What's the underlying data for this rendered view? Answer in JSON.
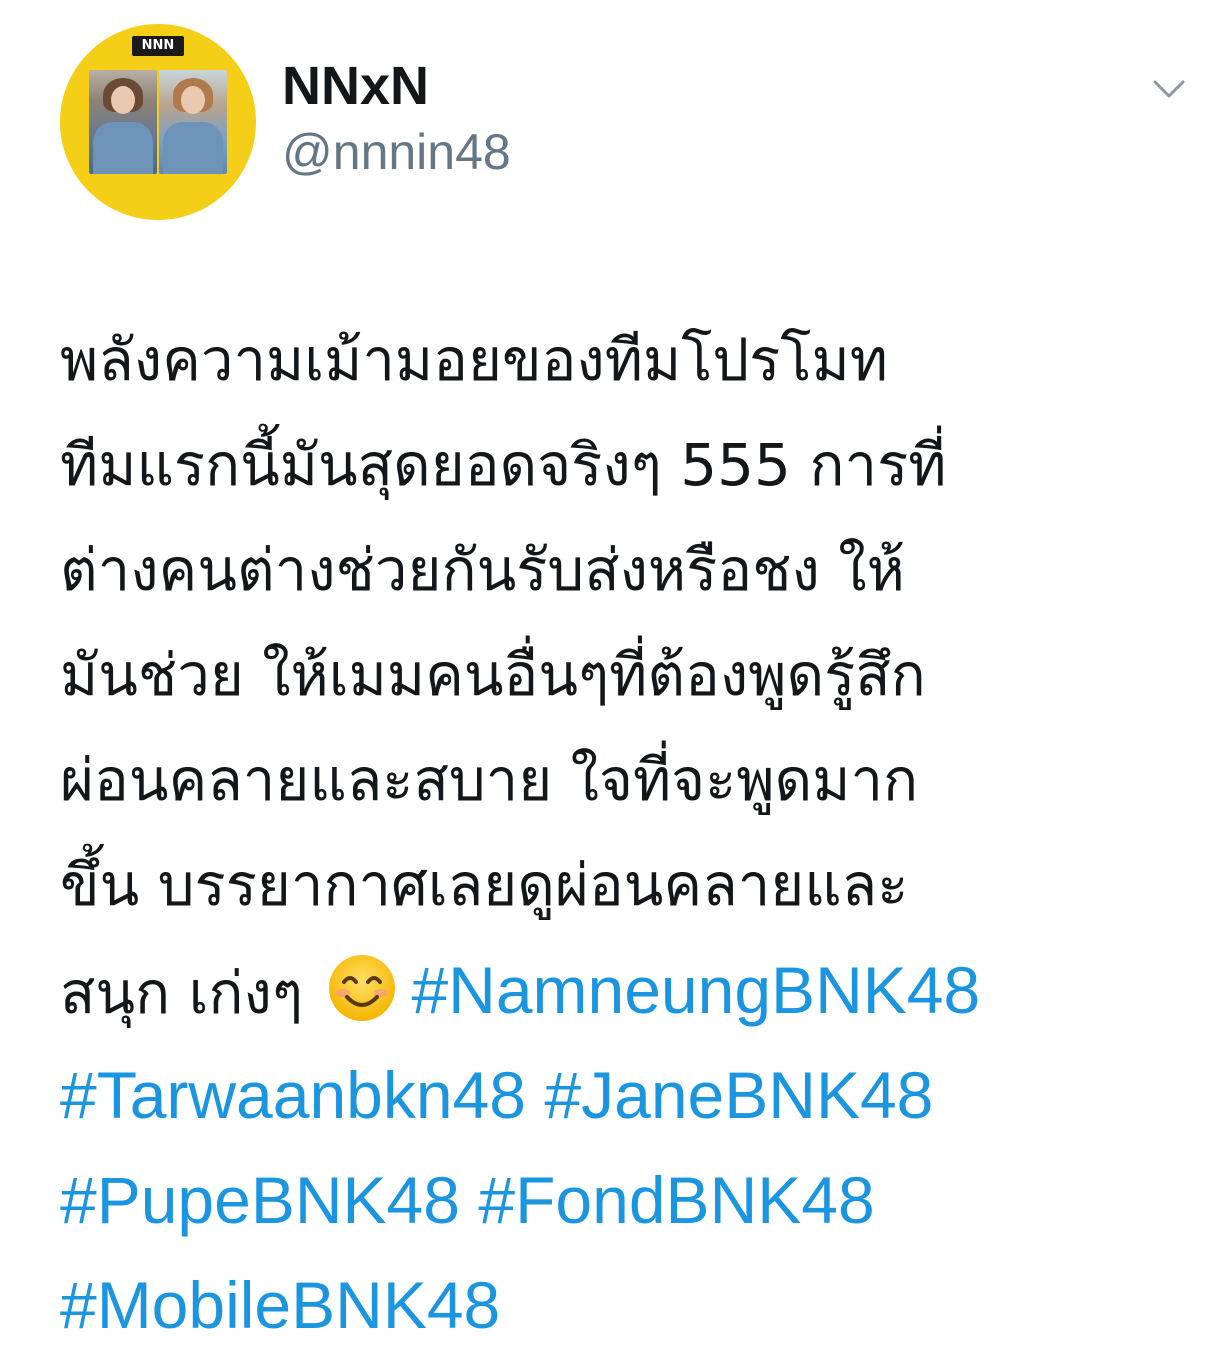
{
  "author": {
    "avatar_badge": "NNN",
    "display_name": "NNxN",
    "handle": "@nnnin48"
  },
  "menu": {
    "icon": "chevron-down-icon"
  },
  "tweet": {
    "lines": [
      "พลังความเม้ามอยของทีมโปรโมท",
      "ทีมแรกนี้มันสุดยอดจริงๆ 555 การที่",
      "ต่างคนต่างช่วยกันรับส่งหรือชง ให้",
      "มันช่วย ให้เมมคนอื่นๆที่ต้องพูดรู้สึก",
      "ผ่อนคลายและสบาย ใจที่จะพูดมาก",
      "ขึ้น บรรยากาศเลยดูผ่อนคลายและ",
      "สนุก เก่งๆ"
    ],
    "emoji": "smiling-face-icon",
    "hashtags": [
      "#NamneungBNK48",
      "#Tarwaanbkn48",
      "#JaneBNK48",
      "#PupeBNK48",
      "#FondBNK48",
      "#MobileBNK48"
    ]
  },
  "colors": {
    "hashtag": "#1b95e0",
    "handle": "#657786",
    "avatar_bg": "#f5cf17"
  }
}
